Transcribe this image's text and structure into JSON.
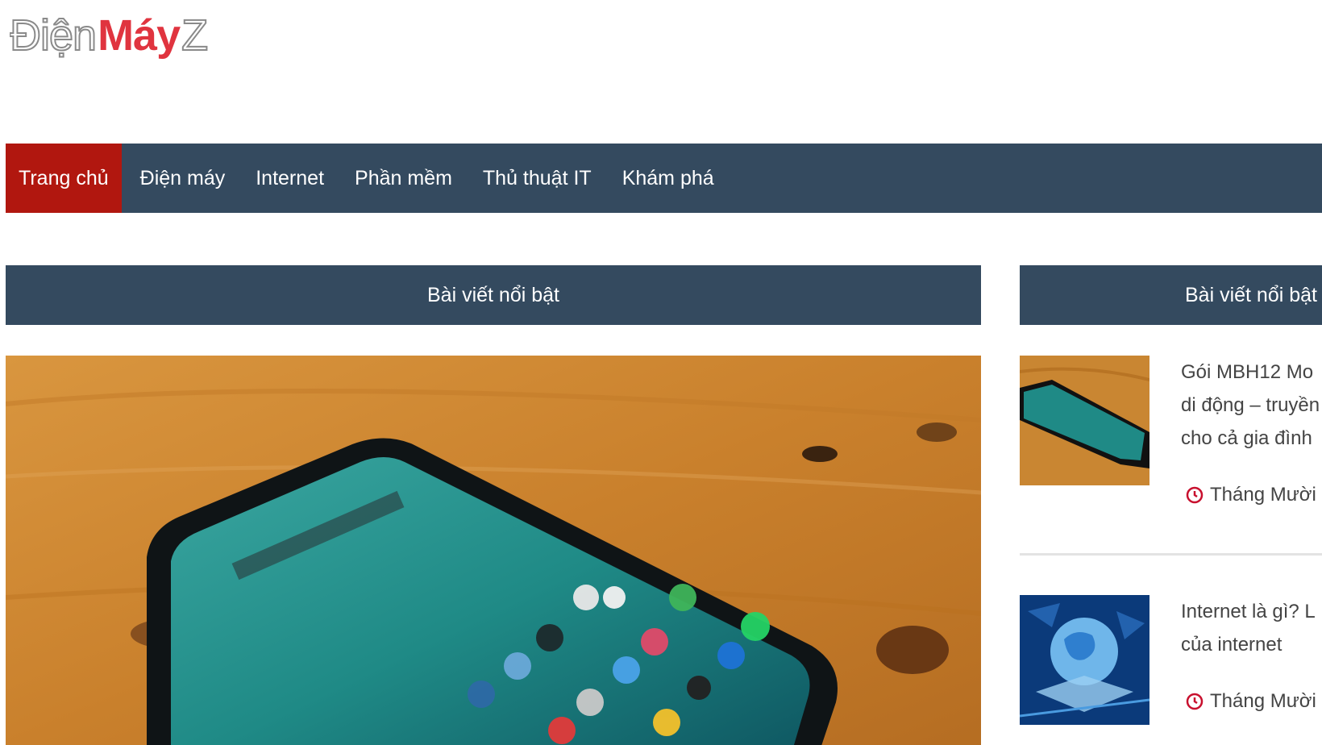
{
  "logo": {
    "part1": "Điện",
    "part2": "Máy",
    "part3": "Z"
  },
  "nav": {
    "items": [
      {
        "label": "Trang chủ",
        "active": true
      },
      {
        "label": "Điện máy",
        "active": false
      },
      {
        "label": "Internet",
        "active": false
      },
      {
        "label": "Phần mềm",
        "active": false
      },
      {
        "label": "Thủ thuật IT",
        "active": false
      },
      {
        "label": "Khám phá",
        "active": false
      }
    ]
  },
  "main": {
    "header": "Bài viết nổi bật"
  },
  "sidebar": {
    "header": "Bài viết nổi bật",
    "posts": [
      {
        "title_lines": [
          "Gói MBH12 Mo",
          "di động – truyền",
          "cho cả gia đình"
        ],
        "date": "Tháng Mười"
      },
      {
        "title_lines": [
          "Internet là gì? L",
          "của internet"
        ],
        "date": "Tháng Mười"
      }
    ]
  },
  "colors": {
    "nav_bg": "#344a5f",
    "active_bg": "#b1170f",
    "brand_red": "#e0343f",
    "clock_red": "#c8102e"
  }
}
